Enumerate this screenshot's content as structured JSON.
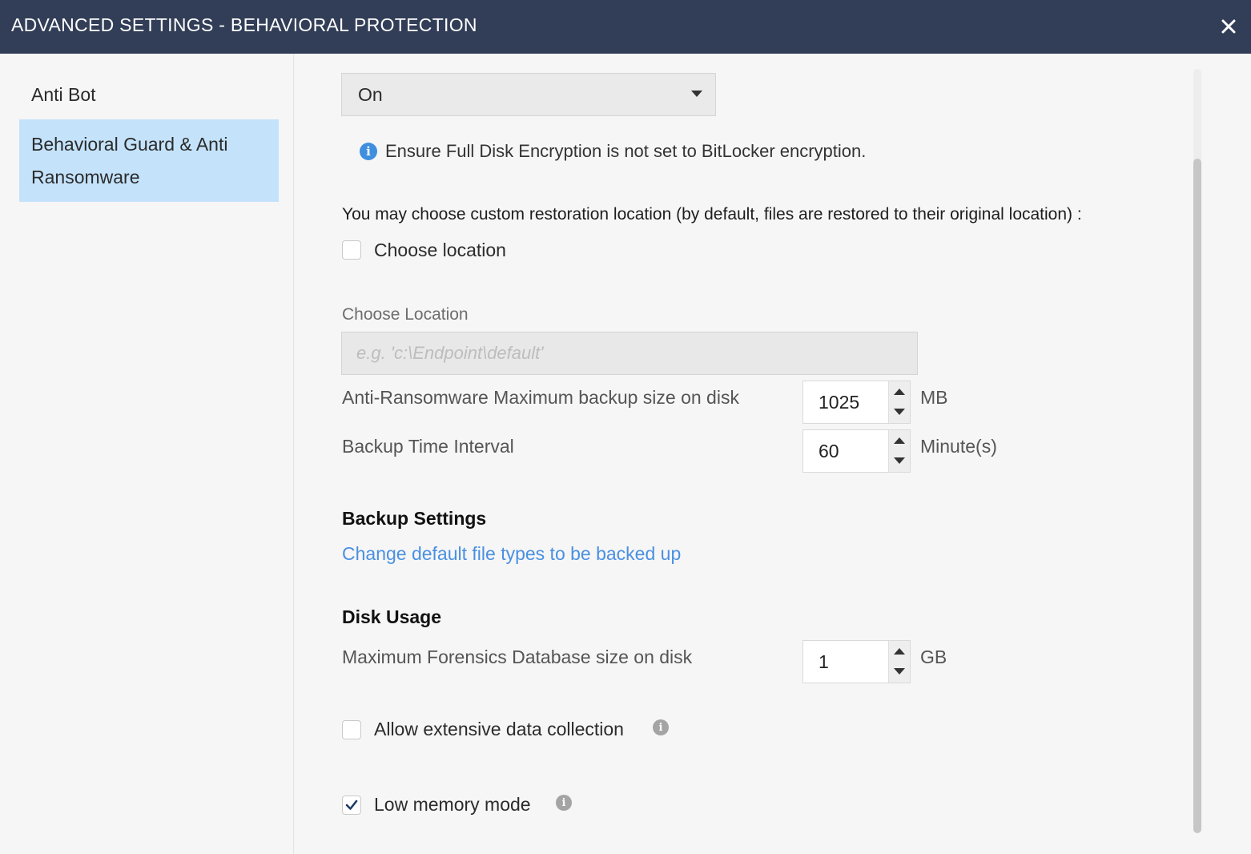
{
  "window": {
    "title": "ADVANCED SETTINGS - BEHAVIORAL PROTECTION",
    "close_glyph": "✕"
  },
  "sidebar": {
    "items": [
      {
        "label": "Anti Bot",
        "active": false
      },
      {
        "label": "Behavioral Guard & Anti Ransomware",
        "active": true
      }
    ]
  },
  "main": {
    "mode_select": {
      "value": "On"
    },
    "info_note": "Ensure Full Disk Encryption is not set to BitLocker encryption.",
    "restore_text": "You may choose custom restoration location (by default, files are restored to their original location) :",
    "choose_location_checkbox": {
      "label": "Choose location",
      "checked": false
    },
    "location_field": {
      "label": "Choose Location",
      "placeholder": "e.g. 'c:\\Endpoint\\default'"
    },
    "backup_size": {
      "label": "Anti-Ransomware Maximum backup size on disk",
      "value": "1025",
      "unit": "MB"
    },
    "backup_interval": {
      "label": "Backup Time Interval",
      "value": "60",
      "unit": "Minute(s)"
    },
    "backup_settings": {
      "title": "Backup Settings",
      "link": "Change default file types to be backed up"
    },
    "disk_usage": {
      "title": "Disk Usage",
      "forensics_size": {
        "label": "Maximum Forensics Database size on disk",
        "value": "1",
        "unit": "GB"
      }
    },
    "extensive_collection": {
      "label": "Allow extensive data collection",
      "checked": false
    },
    "low_memory": {
      "label": "Low memory mode",
      "checked": true
    }
  },
  "colors": {
    "titlebar": "#323e57",
    "active_item": "#c4e3fb",
    "link": "#4a90e2",
    "info_icon": "#3f8fde"
  }
}
